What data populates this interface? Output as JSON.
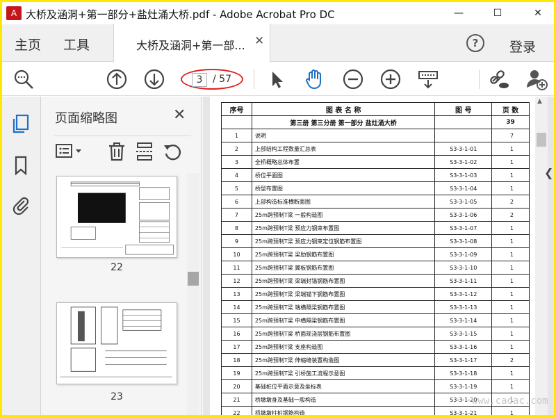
{
  "window": {
    "title": "大桥及涵洞+第一部分+盐灶涌大桥.pdf - Adobe Acrobat Pro DC",
    "controls": {
      "minimize": "—",
      "maximize": "☐",
      "close": "✕"
    }
  },
  "tabs": {
    "home": "主页",
    "tools": "工具",
    "document": "大桥及涵洞+第一部...",
    "document_close": "✕",
    "help": "?",
    "login": "登录"
  },
  "toolbar": {
    "current_page": "3",
    "total_pages": "/ 57"
  },
  "thumbnails_panel": {
    "title": "页面缩略图",
    "close": "✕",
    "pages": [
      {
        "number": "22"
      },
      {
        "number": "23"
      }
    ]
  },
  "document_table": {
    "headers": [
      "序号",
      "图 表 名 称",
      "图  号",
      "页  数"
    ],
    "section": {
      "title": "第三册 第三分册 第一部分 盐灶涌大桥",
      "pages": "39"
    },
    "rows": [
      {
        "no": "1",
        "name": "说明",
        "code": "",
        "pages": "7"
      },
      {
        "no": "2",
        "name": "上部结构工程数量汇总表",
        "code": "S3-3-1-01",
        "pages": "1"
      },
      {
        "no": "3",
        "name": "全桥概略总体布置",
        "code": "S3-3-1-02",
        "pages": "1"
      },
      {
        "no": "4",
        "name": "桥位平面图",
        "code": "S3-3-1-03",
        "pages": "1"
      },
      {
        "no": "5",
        "name": "桥型布置图",
        "code": "S3-3-1-04",
        "pages": "1"
      },
      {
        "no": "6",
        "name": "上部构造标准横断面图",
        "code": "S3-3-1-05",
        "pages": "2"
      },
      {
        "no": "7",
        "name": "25m跨预制T梁 一般构造图",
        "code": "S3-3-1-06",
        "pages": "2"
      },
      {
        "no": "8",
        "name": "25m跨预制T梁 预应力钢束布置图",
        "code": "S3-3-1-07",
        "pages": "1"
      },
      {
        "no": "9",
        "name": "25m跨预制T梁 预应力钢束定位钢筋布置图",
        "code": "S3-3-1-08",
        "pages": "1"
      },
      {
        "no": "10",
        "name": "25m跨预制T梁 梁肋钢筋布置图",
        "code": "S3-3-1-09",
        "pages": "1"
      },
      {
        "no": "11",
        "name": "25m跨预制T梁 翼板钢筋布置图",
        "code": "S3-3-1-10",
        "pages": "1"
      },
      {
        "no": "12",
        "name": "25m跨预制T梁 梁端封锚钢筋布置图",
        "code": "S3-3-1-11",
        "pages": "1"
      },
      {
        "no": "13",
        "name": "25m跨预制T梁 梁端锚下钢筋布置图",
        "code": "S3-3-1-12",
        "pages": "1"
      },
      {
        "no": "14",
        "name": "25m跨预制T梁 端横隔梁钢筋布置图",
        "code": "S3-3-1-13",
        "pages": "1"
      },
      {
        "no": "15",
        "name": "25m跨预制T梁 中横隔梁钢筋布置图",
        "code": "S3-3-1-14",
        "pages": "1"
      },
      {
        "no": "16",
        "name": "25m跨预制T梁 桥面现浇层钢筋布置图",
        "code": "S3-3-1-15",
        "pages": "1"
      },
      {
        "no": "17",
        "name": "25m跨预制T梁 支座构造图",
        "code": "S3-3-1-16",
        "pages": "1"
      },
      {
        "no": "18",
        "name": "25m跨预制T梁 伸缩缝装置构造图",
        "code": "S3-3-1-17",
        "pages": "2"
      },
      {
        "no": "19",
        "name": "25m跨预制T梁 引桥施工流程示意图",
        "code": "S3-3-1-18",
        "pages": "1"
      },
      {
        "no": "20",
        "name": "基础桩位平面示意及坐标表",
        "code": "S3-3-1-19",
        "pages": "1"
      },
      {
        "no": "21",
        "name": "桥墩墩身及基础一般构造",
        "code": "S3-3-1-20",
        "pages": "1"
      },
      {
        "no": "22",
        "name": "桥墩墩柱桩钢筋构造",
        "code": "S3-3-1-21",
        "pages": "1"
      }
    ]
  },
  "watermark": "www.cadac.com"
}
